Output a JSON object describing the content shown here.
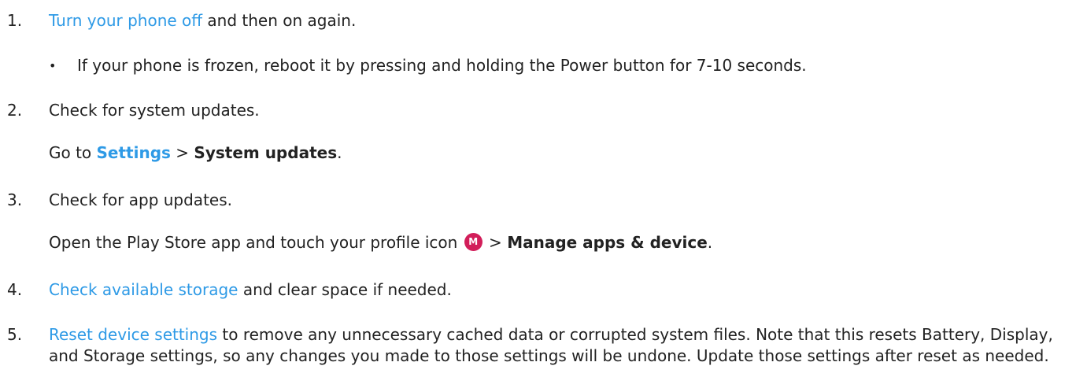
{
  "colors": {
    "link": "#2e9ae6",
    "text": "#222222",
    "avatar_bg": "#d21e5a"
  },
  "steps": [
    {
      "number": "1.",
      "link": "Turn your phone off",
      "text_after": " and then on again.",
      "sub_bullet": {
        "bullet": "•",
        "text": "If your phone is frozen, reboot it by pressing and holding the Power button for 7-10 seconds."
      }
    },
    {
      "number": "2.",
      "title": "Check for system updates.",
      "instruction": {
        "prefix": "Go to ",
        "link": "Settings",
        "separator": " > ",
        "bold": "System updates",
        "suffix": "."
      }
    },
    {
      "number": "3.",
      "title": "Check for app updates.",
      "instruction": {
        "prefix": "Open the Play Store app and touch your profile icon ",
        "avatar_letter": "M",
        "separator": " > ",
        "bold": "Manage apps & device",
        "suffix": "."
      }
    },
    {
      "number": "4.",
      "link": "Check available storage",
      "text_after": " and clear space if needed."
    },
    {
      "number": "5.",
      "link": "Reset device settings",
      "text_after": " to remove any unnecessary cached data or corrupted system files. Note that this resets Battery, Display, and Storage settings, so any changes you made to those settings will be undone. Update those settings after reset as needed."
    }
  ]
}
